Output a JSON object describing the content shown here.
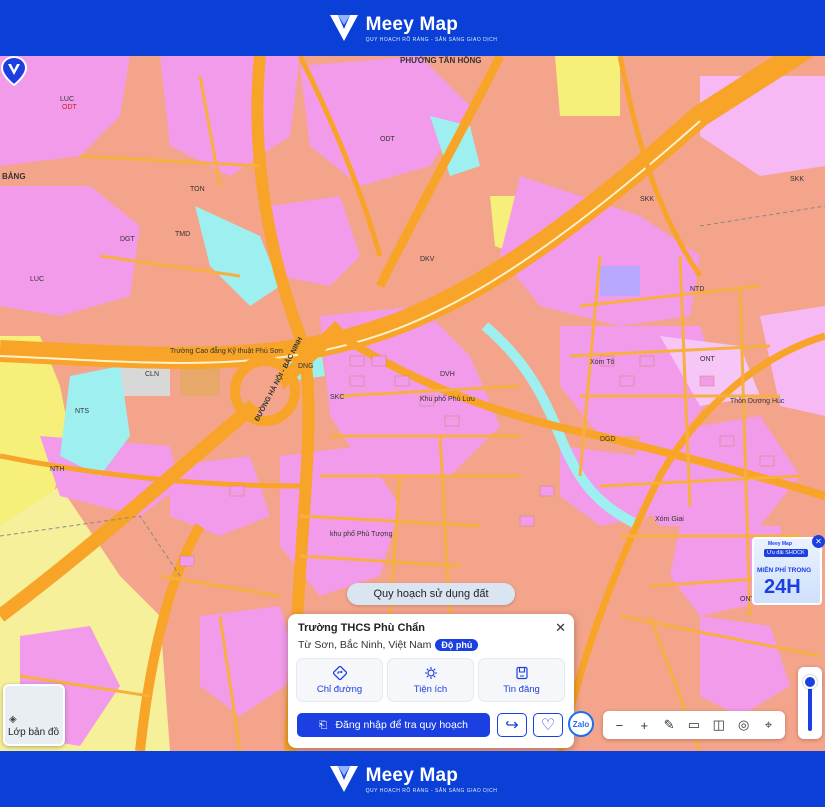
{
  "header": {
    "brand": "Meey Map",
    "tagline": "QUY HOẠCH RÕ RÀNG - SẴN SÀNG GIAO DỊCH"
  },
  "footer": {
    "brand": "Meey Map",
    "tagline": "QUY HOẠCH RÕ RÀNG - SẴN SÀNG GIAO DỊCH"
  },
  "map": {
    "labels": {
      "ward": "PHƯỜNG TÂN HỒNG",
      "bang": "BẢNG",
      "road_hn": "ĐƯỜNG HÀ NỘI - BẮC NINH",
      "cong_ty": "Thôn Dương Húc",
      "phu_lac": "Khu phố Phù Lưu",
      "truong": "Trường Cao đẳng Kỹ thuật Phú Sơn",
      "xom_giai": "Xóm Giai",
      "xom_to": "Xóm Tô",
      "khu_phu": "khu phố Phú Tượng"
    },
    "codes": [
      "LUC",
      "ODT",
      "ONT",
      "SKK",
      "DGD",
      "TMD",
      "NTS",
      "DKV",
      "DGT",
      "CLN",
      "TON",
      "SKC",
      "DNG",
      "NTD",
      "DVH",
      "NTH",
      "ODT",
      "LUC",
      "ONT",
      "SKK"
    ]
  },
  "layer_button": {
    "label": "Lớp bản đồ"
  },
  "planning_chip": {
    "label": "Quy hoạch sử dụng đất"
  },
  "place_card": {
    "title": "Trường THCS Phù Chẩn",
    "address": "Từ Sơn, Bắc Ninh, Việt Nam",
    "badge": "Độ phủ",
    "actions": [
      {
        "label": "Chỉ đường",
        "icon": "directions-icon"
      },
      {
        "label": "Tiện ích",
        "icon": "amenities-icon"
      },
      {
        "label": "Tin đăng",
        "icon": "listing-icon"
      }
    ],
    "login_label": "Đăng nhập để tra quy hoạch"
  },
  "zalo": {
    "label": "Zalo"
  },
  "toolbar": {
    "minus": "−",
    "plus": "+"
  },
  "ad": {
    "brand": "Meey Map",
    "promo": "Ưu đãi SHOCK",
    "free": "MIỄN PHÍ TRONG",
    "hours": "24H"
  },
  "colors": {
    "brand_blue": "#0a3fd8",
    "residential_pink": "#f29bea",
    "land_salmon": "#f4a48a",
    "road_orange": "#f7a428",
    "water_cyan": "#9ef0f0",
    "agri_yellow": "#f6f07a"
  }
}
